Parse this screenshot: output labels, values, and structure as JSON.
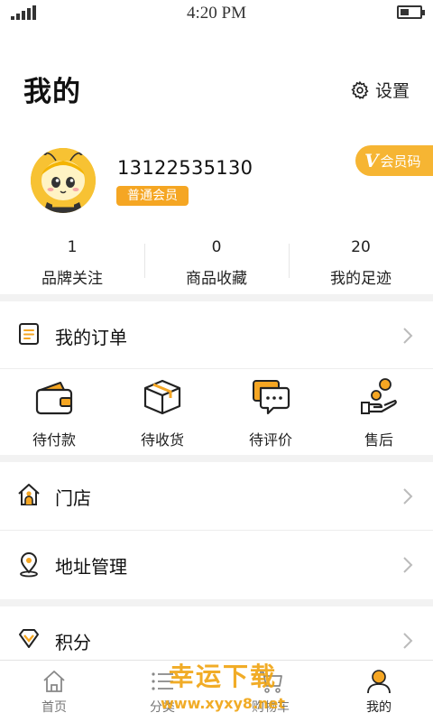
{
  "status_bar": {
    "time": "4:20 PM"
  },
  "header": {
    "title": "我的",
    "settings_label": "设置"
  },
  "profile": {
    "phone": "13122535130",
    "member_level": "普通会员",
    "vip_code_label": "会员码"
  },
  "stats": [
    {
      "value": "1",
      "label": "品牌关注"
    },
    {
      "value": "0",
      "label": "商品收藏"
    },
    {
      "value": "20",
      "label": "我的足迹"
    }
  ],
  "orders": {
    "title": "我的订单",
    "items": [
      {
        "label": "待付款",
        "icon": "wallet-icon"
      },
      {
        "label": "待收货",
        "icon": "package-icon"
      },
      {
        "label": "待评价",
        "icon": "comment-icon"
      },
      {
        "label": "售后",
        "icon": "refund-hand-icon"
      }
    ]
  },
  "menu": {
    "store": "门店",
    "address": "地址管理",
    "points": "积分"
  },
  "tabbar": [
    {
      "label": "首页",
      "icon": "home-icon"
    },
    {
      "label": "分类",
      "icon": "list-icon"
    },
    {
      "label": "购物车",
      "icon": "cart-icon"
    },
    {
      "label": "我的",
      "icon": "user-icon"
    }
  ],
  "watermark": {
    "line1": "幸运下载",
    "line2": "www.xyxy8.net"
  },
  "colors": {
    "accent": "#f5a623",
    "vip_tag": "#f6b533",
    "divider": "#f2f2f2"
  }
}
